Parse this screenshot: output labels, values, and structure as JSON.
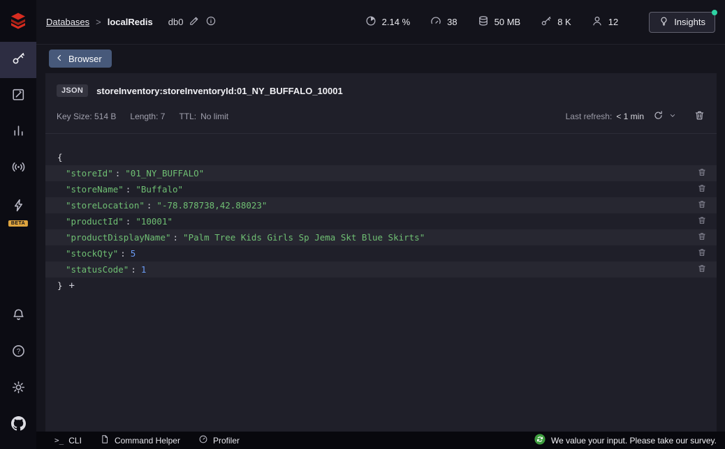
{
  "header": {
    "breadcrumb": {
      "databases": "Databases",
      "separator": ">",
      "current": "localRedis",
      "db": "db0"
    },
    "stats": [
      {
        "name": "cpu-usage",
        "value": "2.14 %"
      },
      {
        "name": "commands-per-sec",
        "value": "38"
      },
      {
        "name": "memory-usage",
        "value": "50 MB"
      },
      {
        "name": "total-keys",
        "value": "8 K"
      },
      {
        "name": "connected-clients",
        "value": "12"
      }
    ],
    "insights_label": "Insights"
  },
  "sidebar": {
    "beta_badge": "BETA"
  },
  "toolbar": {
    "back_label": "Browser"
  },
  "key_detail": {
    "type_badge": "JSON",
    "key_name": "storeInventory:storeInventoryId:01_NY_BUFFALO_10001",
    "key_size_label": "Key Size: 514 B",
    "length_label": "Length: 7",
    "ttl_label": "TTL:",
    "ttl_value": "No limit",
    "last_refresh_label": "Last refresh:",
    "last_refresh_value": "< 1 min"
  },
  "json_view": {
    "open_brace": "{",
    "close_brace": "}",
    "add_button": "+",
    "colon": ":",
    "fields": [
      {
        "key": "\"storeId\"",
        "value": "\"01_NY_BUFFALO\"",
        "type": "string"
      },
      {
        "key": "\"storeName\"",
        "value": "\"Buffalo\"",
        "type": "string"
      },
      {
        "key": "\"storeLocation\"",
        "value": "\"-78.878738,42.88023\"",
        "type": "string"
      },
      {
        "key": "\"productId\"",
        "value": "\"10001\"",
        "type": "string"
      },
      {
        "key": "\"productDisplayName\"",
        "value": "\"Palm Tree Kids Girls Sp Jema Skt Blue Skirts\"",
        "type": "string"
      },
      {
        "key": "\"stockQty\"",
        "value": "5",
        "type": "number"
      },
      {
        "key": "\"statusCode\"",
        "value": "1",
        "type": "number"
      }
    ]
  },
  "bottom_bar": {
    "cli_label": "CLI",
    "command_helper_label": "Command Helper",
    "profiler_label": "Profiler",
    "survey_text": "We value your input. Please take our survey."
  },
  "colors": {
    "brand_red": "#d82c20",
    "json_green": "#6fbf73",
    "number_blue": "#6c9ef8",
    "beta_orange": "#dfa53f",
    "notification_green": "#2ed3a3",
    "accent_button": "#47597a"
  }
}
